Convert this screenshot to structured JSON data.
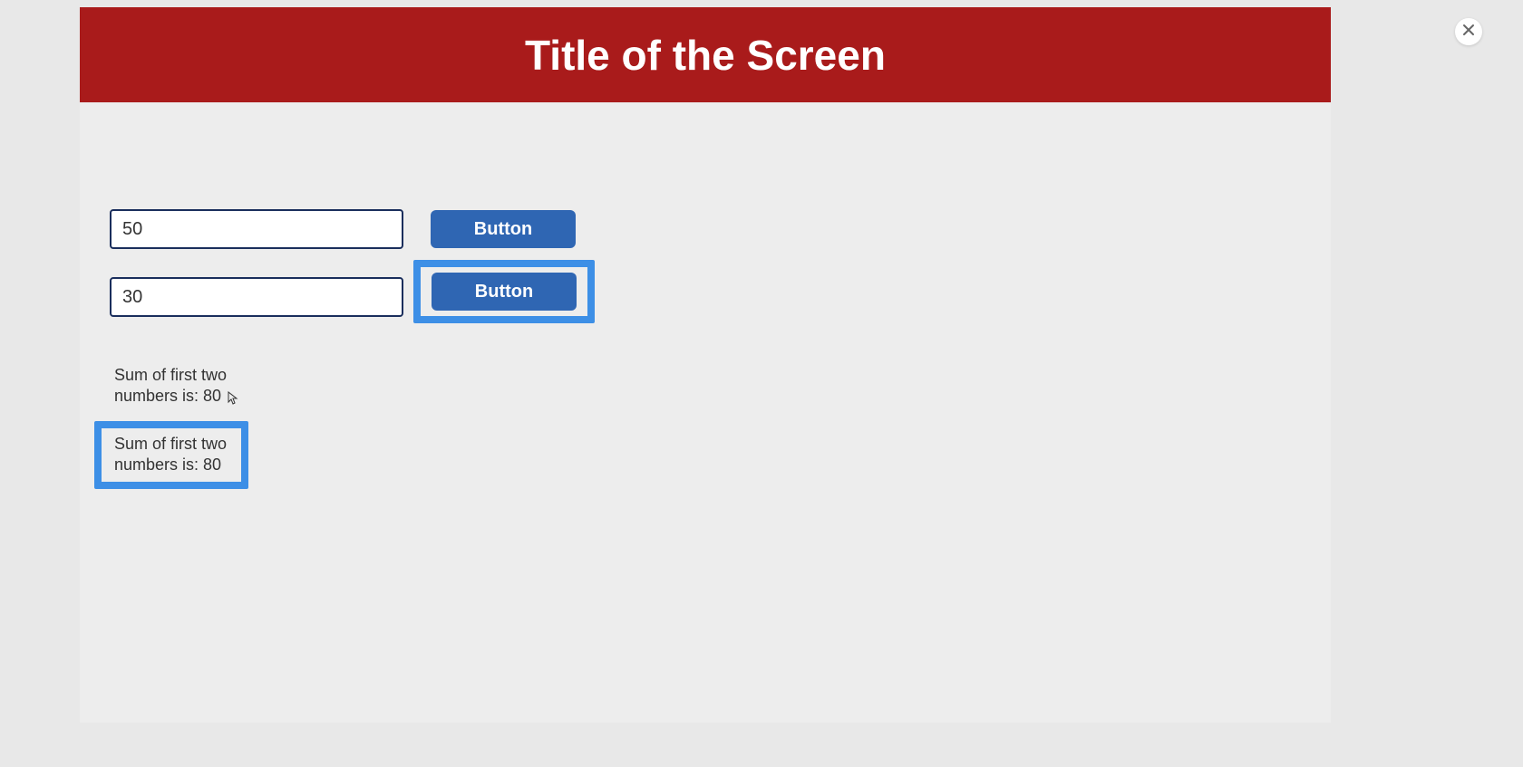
{
  "header": {
    "title": "Title of the Screen"
  },
  "form": {
    "input1": {
      "value": "50"
    },
    "input2": {
      "value": "30"
    },
    "button1_label": "Button",
    "button2_label": "Button"
  },
  "results": {
    "text_plain": "Sum of first two numbers is: 80",
    "text_boxed": "Sum of first two numbers is: 80"
  },
  "close": {
    "label": "×"
  }
}
